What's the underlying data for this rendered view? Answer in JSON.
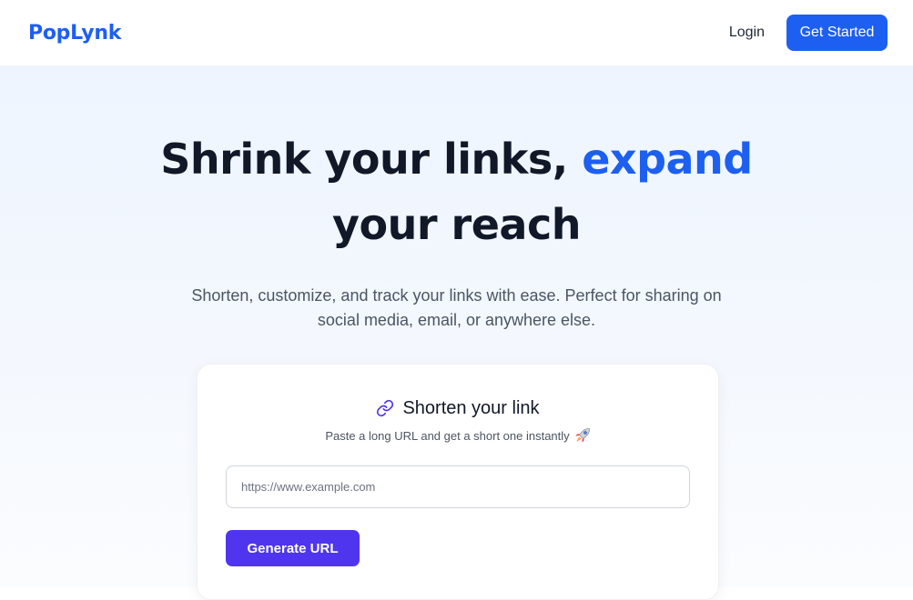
{
  "navbar": {
    "logo": "PopLynk",
    "login_label": "Login",
    "cta_label": "Get Started"
  },
  "hero": {
    "headline_part1": "Shrink your links, ",
    "headline_accent": "expand",
    "headline_part2": " your reach",
    "subtitle": "Shorten, customize, and track your links with ease. Perfect for sharing on social media, email, or anywhere else."
  },
  "card": {
    "icon": "link-icon",
    "title": "Shorten your link",
    "subtitle": "Paste a long URL and get a short one instantly",
    "subtitle_icon": "rocket-icon",
    "input_placeholder": "https://www.example.com",
    "input_value": "",
    "button_label": "Generate URL"
  },
  "colors": {
    "brand": "#1d5ff0",
    "button_purple": "#4f35ee",
    "heading": "#111827",
    "muted": "#4b5563"
  }
}
